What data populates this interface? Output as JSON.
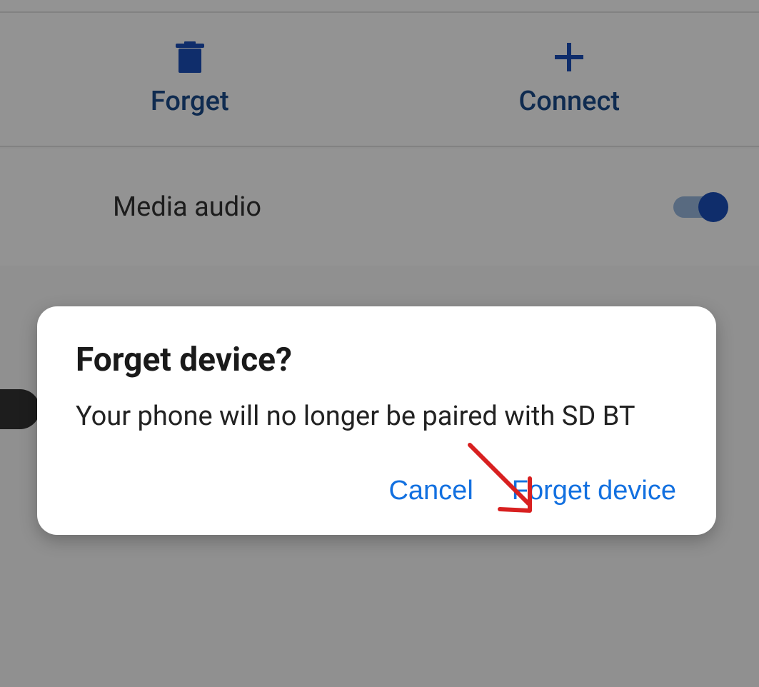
{
  "actions": {
    "forget_label": "Forget",
    "connect_label": "Connect"
  },
  "settings": {
    "media_audio_label": "Media audio",
    "media_audio_enabled": true
  },
  "dialog": {
    "title": "Forget device?",
    "message": "Your phone will no longer be paired with SD BT",
    "cancel_label": "Cancel",
    "confirm_label": "Forget device"
  },
  "icons": {
    "trash": "trash-icon",
    "plus": "plus-icon"
  },
  "colors": {
    "primary": "#1a4fb8",
    "link": "#1270e0",
    "annotation": "#d82020"
  }
}
